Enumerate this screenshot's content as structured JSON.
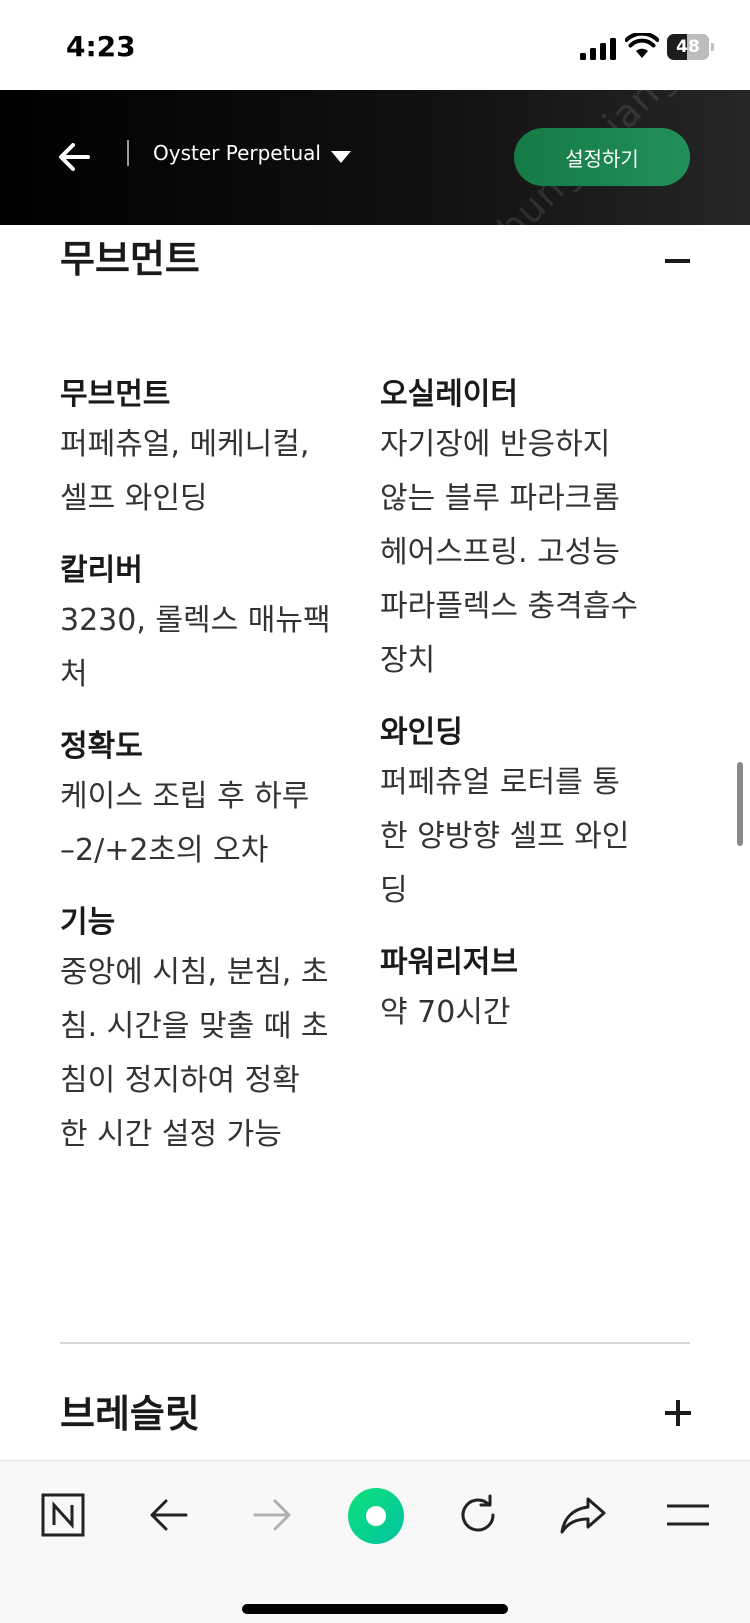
{
  "status_bar": {
    "time": "4:23",
    "battery": "48",
    "battery_level_percent": 48,
    "icons": [
      "cellular-signal-icon",
      "wifi-icon",
      "battery-icon"
    ]
  },
  "header": {
    "back_icon": "arrow-left-icon",
    "model_name": "Oyster Perpetual",
    "dropdown_icon": "caret-down-icon",
    "setup_button": "설정하기",
    "watermark": "bungaejang"
  },
  "movement_section": {
    "title": "무브먼트",
    "toggle_icon": "minus-icon",
    "left_specs": [
      {
        "label": "무브먼트",
        "lines": [
          "퍼페츄얼, 메케니컬,",
          "셀프 와인딩"
        ]
      },
      {
        "label": "칼리버",
        "lines": [
          "3230, 롤렉스 매뉴팩",
          "처"
        ]
      },
      {
        "label": "정확도",
        "lines": [
          "케이스 조립 후 하루",
          "–2/+2초의 오차"
        ]
      },
      {
        "label": "기능",
        "lines": [
          "중앙에 시침, 분침, 초",
          "침. 시간을 맞출 때 초",
          "침이 정지하여 정확",
          "한 시간 설정 가능"
        ]
      }
    ],
    "right_specs": [
      {
        "label": "오실레이터",
        "lines": [
          "자기장에 반응하지",
          "않는 블루 파라크롬",
          "헤어스프링. 고성능",
          "파라플렉스 충격흡수",
          "장치"
        ]
      },
      {
        "label": "와인딩",
        "lines": [
          "퍼페츄얼 로터를 통",
          "한 양방향 셀프 와인",
          "딩"
        ]
      },
      {
        "label": "파워리저브",
        "lines": [
          "약 70시간"
        ]
      }
    ]
  },
  "bracelet_section": {
    "title": "브레슬릿",
    "toggle_icon": "plus-icon"
  },
  "bottom_bar": {
    "items": [
      "naver-n-icon",
      "back-arrow-icon",
      "forward-arrow-icon",
      "green-dot-home-icon",
      "reload-icon",
      "share-icon",
      "menu-icon"
    ],
    "accent_color": "#00d26a"
  }
}
